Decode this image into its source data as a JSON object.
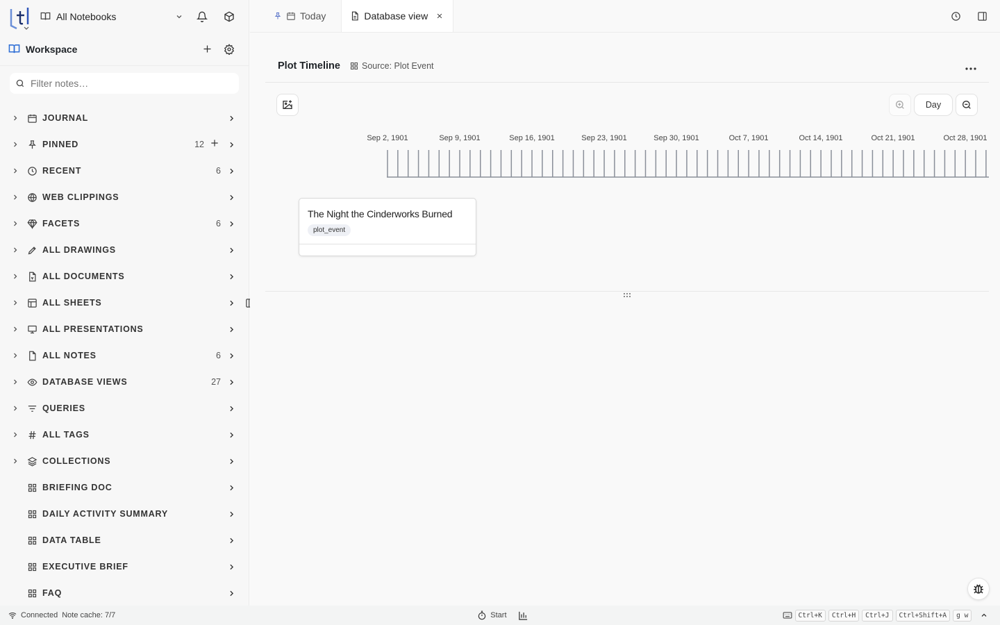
{
  "sidebar": {
    "notebook_select": "All Notebooks",
    "workspace_title": "Workspace",
    "filter_placeholder": "Filter notes…",
    "items": [
      {
        "label": "JOURNAL",
        "count": "",
        "icon": "calendar-icon",
        "expandable": true
      },
      {
        "label": "PINNED",
        "count": "12",
        "icon": "pin-icon",
        "expandable": true,
        "add": true
      },
      {
        "label": "RECENT",
        "count": "6",
        "icon": "clock-icon",
        "expandable": true
      },
      {
        "label": "WEB CLIPPINGS",
        "count": "",
        "icon": "globe-icon",
        "expandable": true
      },
      {
        "label": "FACETS",
        "count": "6",
        "icon": "gem-icon",
        "expandable": true
      },
      {
        "label": "ALL DRAWINGS",
        "count": "",
        "icon": "pencil-icon",
        "expandable": true
      },
      {
        "label": "ALL DOCUMENTS",
        "count": "",
        "icon": "document-icon",
        "expandable": true
      },
      {
        "label": "ALL SHEETS",
        "count": "",
        "icon": "sheet-icon",
        "expandable": true
      },
      {
        "label": "ALL PRESENTATIONS",
        "count": "",
        "icon": "presentation-icon",
        "expandable": true
      },
      {
        "label": "ALL NOTES",
        "count": "6",
        "icon": "note-icon",
        "expandable": true
      },
      {
        "label": "DATABASE VIEWS",
        "count": "27",
        "icon": "eye-icon",
        "expandable": true
      },
      {
        "label": "QUERIES",
        "count": "",
        "icon": "filter-icon",
        "expandable": true
      },
      {
        "label": "ALL TAGS",
        "count": "",
        "icon": "hash-icon",
        "expandable": true
      },
      {
        "label": "COLLECTIONS",
        "count": "",
        "icon": "layers-icon",
        "expandable": true
      },
      {
        "label": "BRIEFING DOC",
        "count": "",
        "icon": "grid-icon",
        "expandable": false
      },
      {
        "label": "DAILY ACTIVITY SUMMARY",
        "count": "",
        "icon": "grid-icon",
        "expandable": false
      },
      {
        "label": "DATA TABLE",
        "count": "",
        "icon": "grid-icon",
        "expandable": false
      },
      {
        "label": "EXECUTIVE BRIEF",
        "count": "",
        "icon": "grid-icon",
        "expandable": false
      },
      {
        "label": "FAQ",
        "count": "",
        "icon": "grid-icon",
        "expandable": false
      }
    ]
  },
  "tabs": [
    {
      "label": "Today",
      "active": false
    },
    {
      "label": "Database view",
      "active": true
    }
  ],
  "view": {
    "title": "Plot Timeline",
    "source": "Source: Plot Event",
    "zoom_level": "Day"
  },
  "timeline": {
    "dates": [
      "Sep 2, 1901",
      "Sep 9, 1901",
      "Sep 16, 1901",
      "Sep 23, 1901",
      "Sep 30, 1901",
      "Oct 7, 1901",
      "Oct 14, 1901",
      "Oct 21, 1901",
      "Oct 28, 1901"
    ],
    "event": {
      "title": "The Night the Cinderworks Burned",
      "tag": "plot_event"
    }
  },
  "status": {
    "connection": "Connected",
    "cache": "Note cache: 7/7",
    "start": "Start",
    "shortcuts": [
      "Ctrl+K",
      "Ctrl+H",
      "Ctrl+J",
      "Ctrl+Shift+A",
      "g w"
    ]
  }
}
